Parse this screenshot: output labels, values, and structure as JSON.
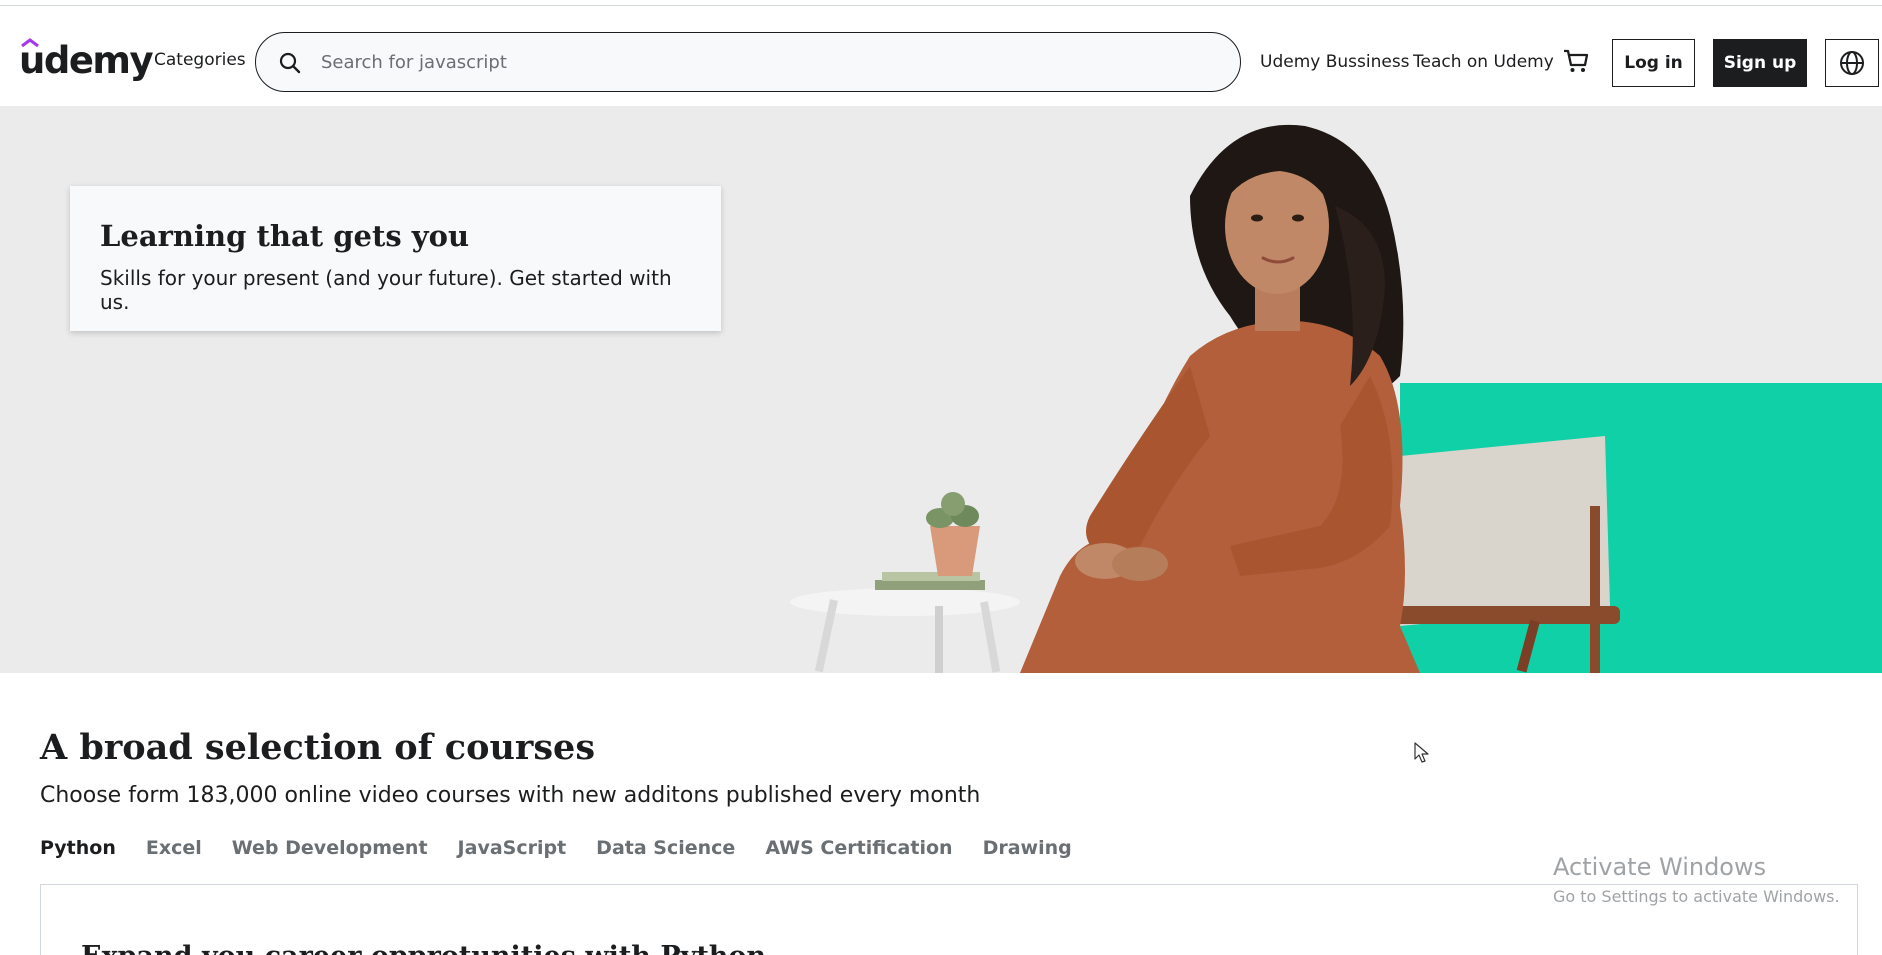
{
  "header": {
    "logo": "udemy",
    "categories_label": "Categories",
    "search_placeholder": "Search for javascript",
    "business_link": "Udemy Bussiness",
    "teach_link": "Teach on Udemy",
    "login_label": "Log in",
    "signup_label": "Sign up"
  },
  "hero": {
    "title": "Learning that gets you",
    "subtitle": "Skills for your present (and your future). Get started with us."
  },
  "courses": {
    "title": "A broad selection of courses",
    "subtitle": "Choose form 183,000 online video courses with new additons published every month",
    "tabs": [
      "Python",
      "Excel",
      "Web Development",
      "JavaScript",
      "Data Science",
      "AWS Certification",
      "Drawing"
    ],
    "active_tab": "Python",
    "box_title": "Expand you career opprotunities with Python"
  },
  "watermark": {
    "title": "Activate Windows",
    "subtitle": "Go to Settings to activate Windows."
  },
  "icons": [
    "search-icon",
    "cart-icon",
    "globe-icon",
    "cursor-icon"
  ],
  "colors": {
    "logo_accent": "#a435f0",
    "hero_accent": "#10d0a8",
    "text": "#1c1d1f",
    "muted": "#6a6f73"
  }
}
